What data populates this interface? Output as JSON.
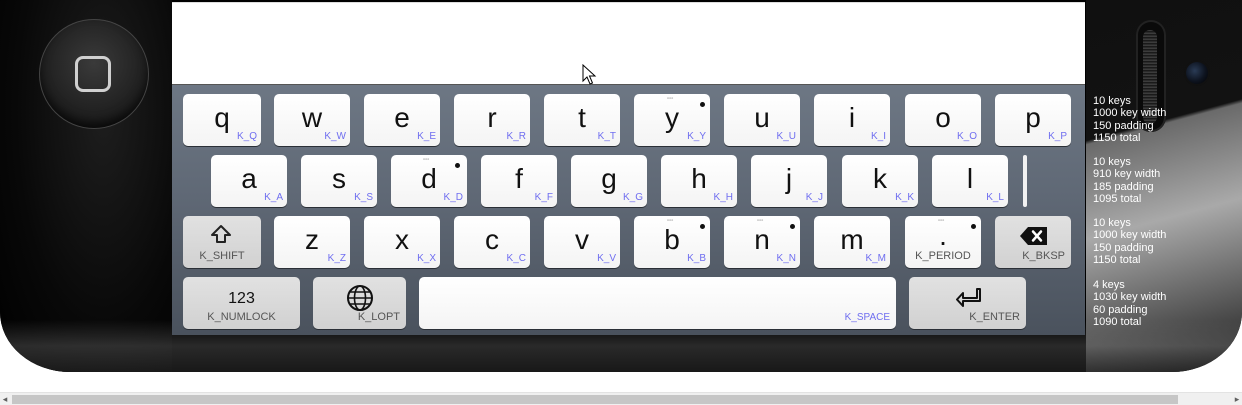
{
  "home_button": {
    "icon": "home-square-icon"
  },
  "stats": [
    [
      "10 keys",
      "1000 key width",
      "150 padding",
      "1150 total"
    ],
    [
      "10 keys",
      "910 key width",
      "185 padding",
      "1095 total"
    ],
    [
      "10 keys",
      "1000 key width",
      "150 padding",
      "1150 total"
    ],
    [
      "4 keys",
      "1030 key width",
      "60 padding",
      "1090 total"
    ]
  ],
  "keys": {
    "q": {
      "label": "q",
      "code": "K_Q"
    },
    "w": {
      "label": "w",
      "code": "K_W"
    },
    "e": {
      "label": "e",
      "code": "K_E"
    },
    "r": {
      "label": "r",
      "code": "K_R"
    },
    "t": {
      "label": "t",
      "code": "K_T"
    },
    "y": {
      "label": "y",
      "code": "K_Y"
    },
    "u": {
      "label": "u",
      "code": "K_U"
    },
    "i": {
      "label": "i",
      "code": "K_I"
    },
    "o": {
      "label": "o",
      "code": "K_O"
    },
    "p": {
      "label": "p",
      "code": "K_P"
    },
    "a": {
      "label": "a",
      "code": "K_A"
    },
    "s": {
      "label": "s",
      "code": "K_S"
    },
    "d": {
      "label": "d",
      "code": "K_D"
    },
    "f": {
      "label": "f",
      "code": "K_F"
    },
    "g": {
      "label": "g",
      "code": "K_G"
    },
    "h": {
      "label": "h",
      "code": "K_H"
    },
    "j": {
      "label": "j",
      "code": "K_J"
    },
    "k": {
      "label": "k",
      "code": "K_K"
    },
    "l": {
      "label": "l",
      "code": "K_L"
    },
    "shift": {
      "icon": "shift-arrow-icon",
      "code": "K_SHIFT"
    },
    "z": {
      "label": "z",
      "code": "K_Z"
    },
    "x": {
      "label": "x",
      "code": "K_X"
    },
    "c": {
      "label": "c",
      "code": "K_C"
    },
    "v": {
      "label": "v",
      "code": "K_V"
    },
    "b": {
      "label": "b",
      "code": "K_B"
    },
    "n": {
      "label": "n",
      "code": "K_N"
    },
    "m": {
      "label": "m",
      "code": "K_M"
    },
    "period": {
      "label": ".",
      "code": "K_PERIOD"
    },
    "bksp": {
      "icon": "backspace-icon",
      "code": "K_BKSP"
    },
    "numlock": {
      "label": "123",
      "code": "K_NUMLOCK"
    },
    "lopt": {
      "icon": "globe-icon",
      "code": "K_LOPT"
    },
    "space": {
      "code": "K_SPACE"
    },
    "enter": {
      "icon": "enter-return-icon",
      "code": "K_ENTER"
    }
  },
  "scrollbar": {
    "left_arrow": "◂",
    "right_arrow": "▸"
  }
}
